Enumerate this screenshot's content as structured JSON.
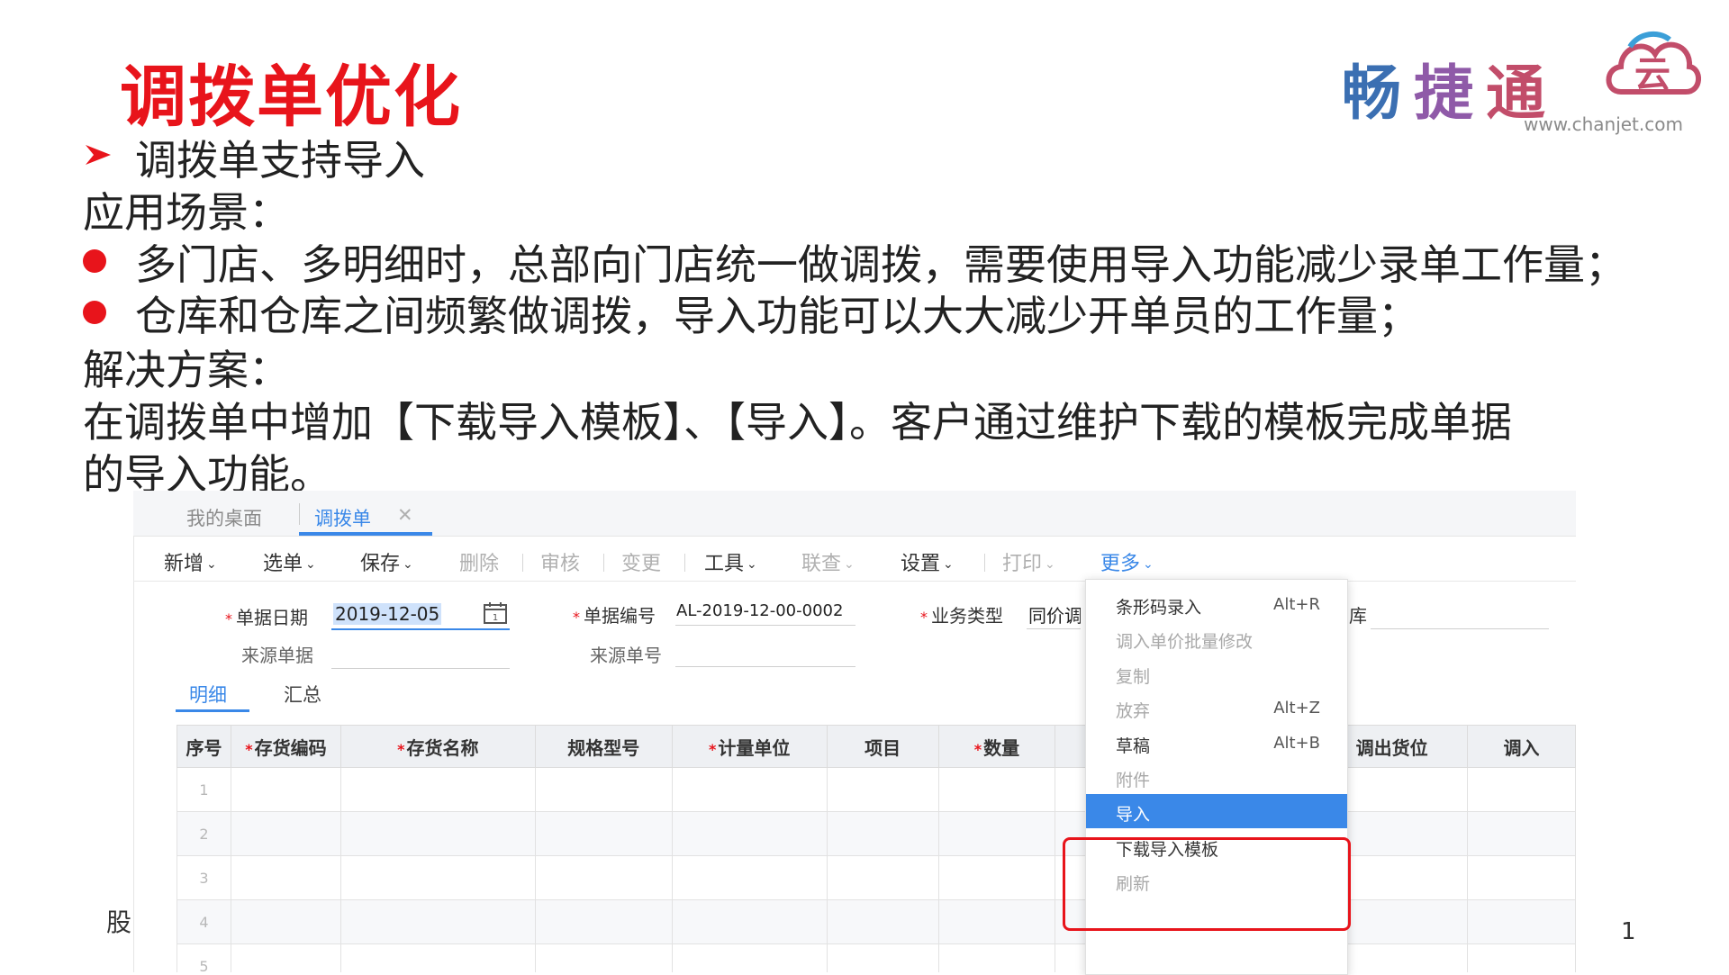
{
  "slide": {
    "title": "调拨单优化",
    "feature": "调拨单支持导入",
    "scenario_heading": "应用场景：",
    "bullets": [
      "多门店、多明细时，总部向门店统一做调拨，需要使用导入功能减少录单工作量；",
      "仓库和仓库之间频繁做调拨，导入功能可以大大减少开单员的工作量；"
    ],
    "solution_heading": "解决方案：",
    "solution_line1": "在调拨单中增加【下载导入模板】、【导入】。客户通过维护下载的模板完成单据",
    "solution_line2": "的导入功能。",
    "footer_left": "股",
    "page_number": "1",
    "accent_color": "#e8141b"
  },
  "logo": {
    "chars": [
      "畅",
      "捷",
      "通"
    ],
    "cloud_char": "云",
    "url": "www.chanjet.com"
  },
  "app": {
    "accent_color": "#3a88e8",
    "tabs": [
      {
        "label": "我的桌面",
        "active": false
      },
      {
        "label": "调拨单",
        "active": true,
        "close": "✕"
      }
    ],
    "toolbar": {
      "new": "新增",
      "select": "选单",
      "save": "保存",
      "delete": "删除",
      "audit": "审核",
      "change": "变更",
      "tools": "工具",
      "linked": "联查",
      "settings": "设置",
      "print": "打印",
      "more": "更多"
    },
    "form": {
      "date_label": "单据日期",
      "date_value": "2019-12-05",
      "doc_no_label": "单据编号",
      "doc_no_value": "AL-2019-12-00-0002",
      "biz_type_label": "业务类型",
      "biz_type_value": "同价调",
      "warehouse_label_partial": "库",
      "source_doc_label": "来源单据",
      "source_no_label": "来源单号"
    },
    "subtabs": {
      "detail": "明细",
      "summary": "汇总"
    },
    "grid": {
      "columns": [
        {
          "label": "序号",
          "required": false
        },
        {
          "label": "存货编码",
          "required": true
        },
        {
          "label": "存货名称",
          "required": true
        },
        {
          "label": "规格型号",
          "required": false
        },
        {
          "label": "计量单位",
          "required": true
        },
        {
          "label": "项目",
          "required": false
        },
        {
          "label": "数量",
          "required": true
        },
        {
          "label": "",
          "required": false
        },
        {
          "label": "调出货位",
          "required": false
        },
        {
          "label": "调入",
          "required": false
        }
      ],
      "rows": [
        "1",
        "2",
        "3",
        "4",
        "5"
      ]
    },
    "more_menu": [
      {
        "label": "条形码录入",
        "shortcut": "Alt+R",
        "disabled": false
      },
      {
        "label": "调入单价批量修改",
        "shortcut": "",
        "disabled": true
      },
      {
        "label": "复制",
        "shortcut": "",
        "disabled": true
      },
      {
        "label": "放弃",
        "shortcut": "Alt+Z",
        "disabled": true
      },
      {
        "label": "草稿",
        "shortcut": "Alt+B",
        "disabled": false
      },
      {
        "label": "附件",
        "shortcut": "",
        "disabled": true
      },
      {
        "label": "导入",
        "shortcut": "",
        "disabled": false,
        "selected": true
      },
      {
        "label": "下载导入模板",
        "shortcut": "",
        "disabled": false
      },
      {
        "label": "刷新",
        "shortcut": "",
        "disabled": true
      }
    ]
  }
}
